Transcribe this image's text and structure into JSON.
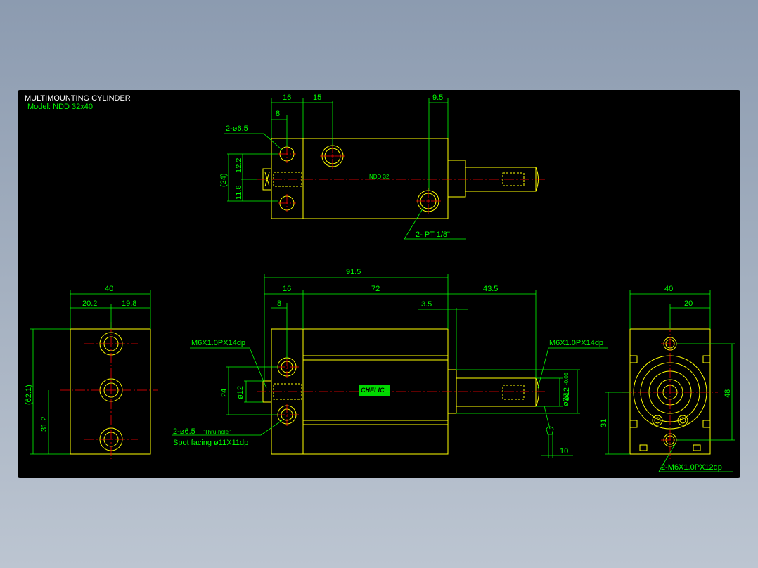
{
  "title": {
    "line1": "MULTIMOUNTING CYLINDER",
    "line2": "Model: NDD 32x40"
  },
  "colors": {
    "background": "#000000",
    "outline": "#ffff00",
    "dimension": "#00ff00",
    "centerline": "#ff0000",
    "title_text": "#ffffff"
  },
  "top_view": {
    "dim_16": "16",
    "dim_15": "15",
    "dim_9_5": "9.5",
    "dim_8": "8",
    "hole_callout": "2-ø6.5",
    "dim_24": "(24)",
    "dim_12_2": "12.2",
    "dim_11_8": "11.8",
    "port_callout": "2- PT 1/8\"",
    "center_label": "NDD 32"
  },
  "front_view": {
    "dim_91_5": "91.5",
    "dim_16": "16",
    "dim_72": "72",
    "dim_43_5": "43.5",
    "dim_8": "8",
    "dim_3_5": "3.5",
    "thread_left": "M6X1.0PX14dp",
    "thread_right": "M6X1.0PX14dp",
    "dim_24": "24",
    "dim_phi12_left": "ø12",
    "dim_phi12_right": "ø12",
    "dim_phi22": "ø22",
    "dim_phi22_tol": "-0.05",
    "hole_callout_1": "2-ø6.5",
    "hole_callout_1_sub": "\"Thru-hole\"",
    "hole_callout_2": "Spot facing  ø11X11dp",
    "dim_10": "10",
    "badge": "CHELIC"
  },
  "left_view": {
    "dim_40": "40",
    "dim_20_2": "20.2",
    "dim_19_8": "19.8",
    "dim_62_1": "(62.1)",
    "dim_31_2": "31.2"
  },
  "right_view": {
    "dim_40": "40",
    "dim_20": "20",
    "dim_48": "48",
    "dim_31": "31",
    "thread_callout": "2-M6X1.0PX12dp"
  }
}
